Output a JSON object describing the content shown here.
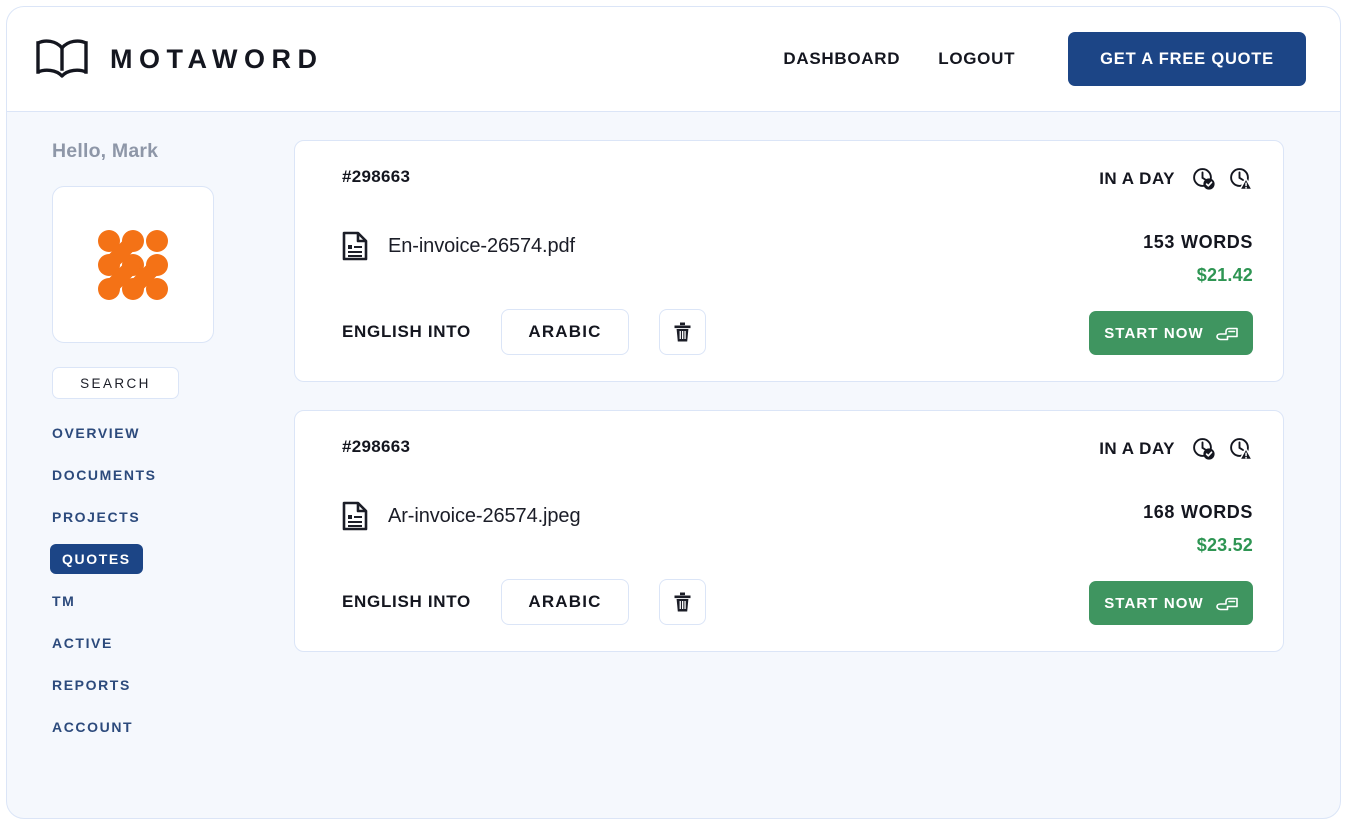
{
  "header": {
    "logo_icon": "open-book-icon",
    "brand": "MOTAWORD",
    "nav": [
      {
        "label": "DASHBOARD",
        "name": "dashboard"
      },
      {
        "label": "LOGOUT",
        "name": "logout"
      }
    ],
    "cta_label": "GET A FREE QUOTE",
    "cta_color": "#1c4586"
  },
  "sidebar": {
    "greeting": "Hello, Mark",
    "avatar_icon": "orange-dot-grid-avatar",
    "avatar_color": "#f47216",
    "search_label": "SEARCH",
    "items": [
      {
        "label": "OVERVIEW",
        "name": "overview",
        "active": false
      },
      {
        "label": "DOCUMENTS",
        "name": "documents",
        "active": false
      },
      {
        "label": "PROJECTS",
        "name": "projects",
        "active": false
      },
      {
        "label": "QUOTES",
        "name": "quotes",
        "active": true
      },
      {
        "label": "TM",
        "name": "tm",
        "active": false
      },
      {
        "label": "ACTIVE",
        "name": "active",
        "active": false
      },
      {
        "label": "REPORTS",
        "name": "reports",
        "active": false
      },
      {
        "label": "ACCOUNT",
        "name": "account",
        "active": false
      }
    ],
    "active_color": "#1c4586",
    "link_color": "#2c4a7c"
  },
  "main": {
    "quotes": [
      {
        "id": "#298663",
        "file_icon": "document-icon",
        "file_name": "En-invoice-26574.pdf",
        "source_label": "ENGLISH INTO",
        "target_language": "ARABIC",
        "delete_icon": "trash-icon",
        "delivery": "IN A DAY",
        "status_icons": [
          "clock-check-icon",
          "clock-warning-icon"
        ],
        "word_count": "153",
        "words_label": "WORDS",
        "price": "$21.42",
        "start_label": "START NOW",
        "start_icon": "hand-pointer-icon"
      },
      {
        "id": "#298663",
        "file_icon": "document-icon",
        "file_name": "Ar-invoice-26574.jpeg",
        "source_label": "ENGLISH INTO",
        "target_language": "ARABIC",
        "delete_icon": "trash-icon",
        "delivery": "IN A DAY",
        "status_icons": [
          "clock-check-icon",
          "clock-warning-icon"
        ],
        "word_count": "168",
        "words_label": "WORDS",
        "price": "$23.52",
        "start_label": "START NOW",
        "start_icon": "hand-pointer-icon"
      }
    ],
    "price_color": "#2e9553",
    "start_button_color": "#3f9560"
  }
}
